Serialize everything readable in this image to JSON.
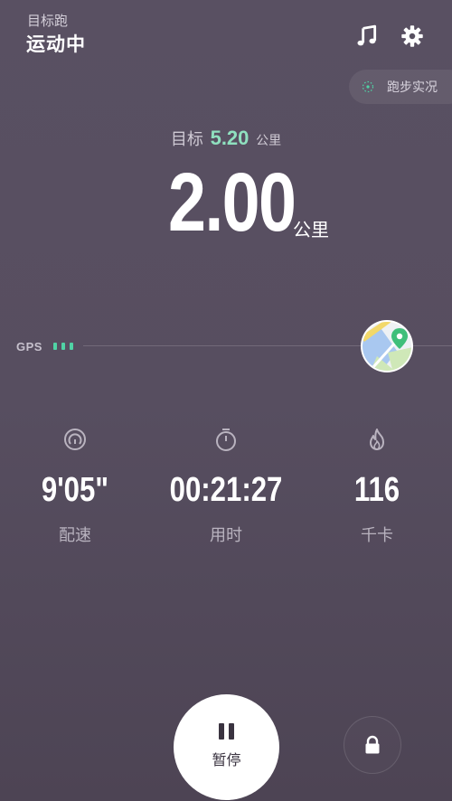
{
  "header": {
    "subtitle": "目标跑",
    "title": "运动中",
    "music_icon": "music-note-icon",
    "settings_icon": "gear-icon"
  },
  "live_status": {
    "label": "跑步实况",
    "icon": "live-dot-icon"
  },
  "goal": {
    "prefix": "目标",
    "value": "5.20",
    "unit": "公里"
  },
  "distance": {
    "value": "2.00",
    "unit": "公里"
  },
  "gps": {
    "label": "GPS",
    "signal_bars": 3
  },
  "map": {
    "icon": "map-pin-icon"
  },
  "stats": {
    "pace": {
      "value": "9'05\"",
      "label": "配速",
      "icon": "pace-gauge-icon"
    },
    "duration": {
      "value": "00:21:27",
      "label": "用时",
      "icon": "stopwatch-icon"
    },
    "calories": {
      "value": "116",
      "label": "千卡",
      "icon": "flame-icon"
    }
  },
  "controls": {
    "pause_label": "暂停",
    "lock_icon": "lock-icon"
  },
  "colors": {
    "accent_green": "#50d3a5",
    "goal_value": "#8fe0bf",
    "background": "#575060"
  }
}
